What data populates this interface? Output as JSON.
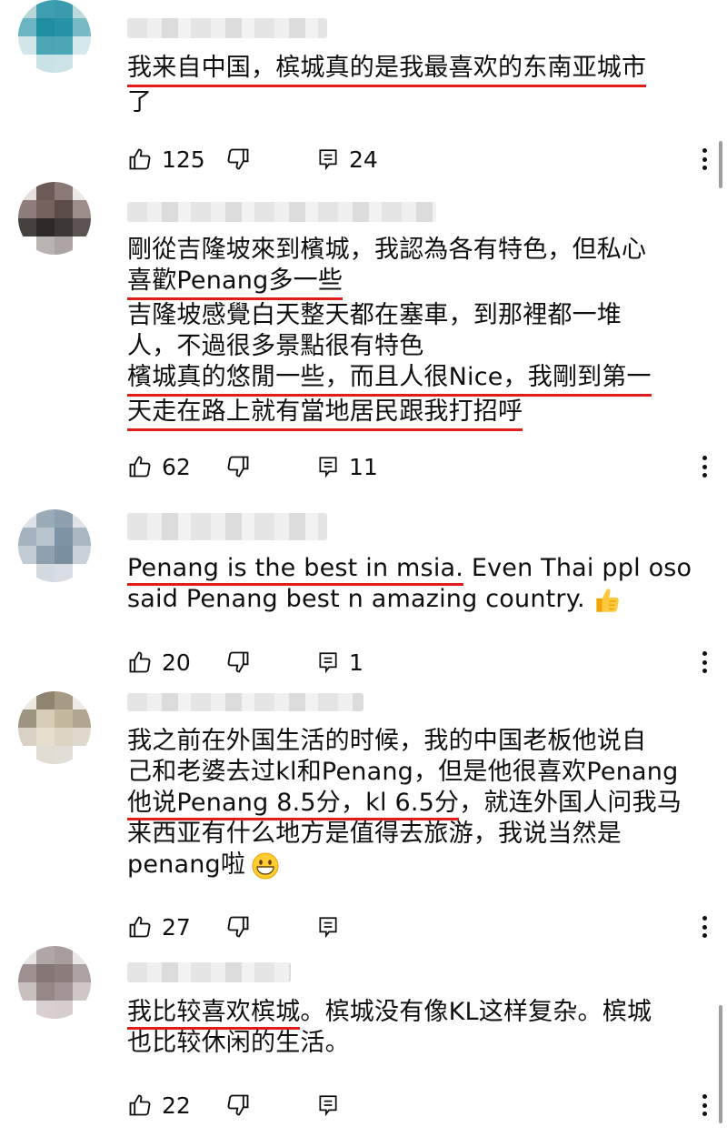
{
  "comments": [
    {
      "lines": [
        "我来自中国，槟城真的是我最喜欢的东南亚城市",
        "了"
      ],
      "likes": "125",
      "replies": "24"
    },
    {
      "lines": [
        "剛從吉隆坡來到檳城，我認為各有特色，但私心",
        "喜歡Penang多一些",
        "吉隆坡感覺白天整天都在塞車，到那裡都一堆",
        "人，不過很多景點很有特色",
        "檳城真的悠閒一些，而且人很Nice，我剛到第一",
        "天走在路上就有當地居民跟我打招呼"
      ],
      "likes": "62",
      "replies": "11"
    },
    {
      "lines": [
        "Penang is the best in msia.",
        " Even Thai ppl oso",
        "said Penang best n amazing country."
      ],
      "likes": "20",
      "replies": "1"
    },
    {
      "lines": [
        "我之前在外国生活的时候，我的中国老板他说自",
        "己和老婆去过kl和Penang，但是他很喜欢Penang",
        "他说Penang 8.5分，kl 6.5分",
        "，就连外国人问我马",
        "来西亚有什么地方是值得去旅游，我说当然是",
        "penang啦"
      ],
      "likes": "27",
      "replies": ""
    },
    {
      "lines": [
        "我比较喜欢槟城",
        "。槟城没有像KL这样复杂。槟城",
        "也比较休闲的生活。"
      ],
      "likes": "22",
      "replies": ""
    }
  ],
  "icons": {
    "like": "thumbs-up-icon",
    "dislike": "thumbs-down-icon",
    "reply": "reply-icon",
    "more": "more-vert-icon"
  },
  "colors": {
    "underline": "#e21b1b",
    "text": "#0f0f0f"
  }
}
